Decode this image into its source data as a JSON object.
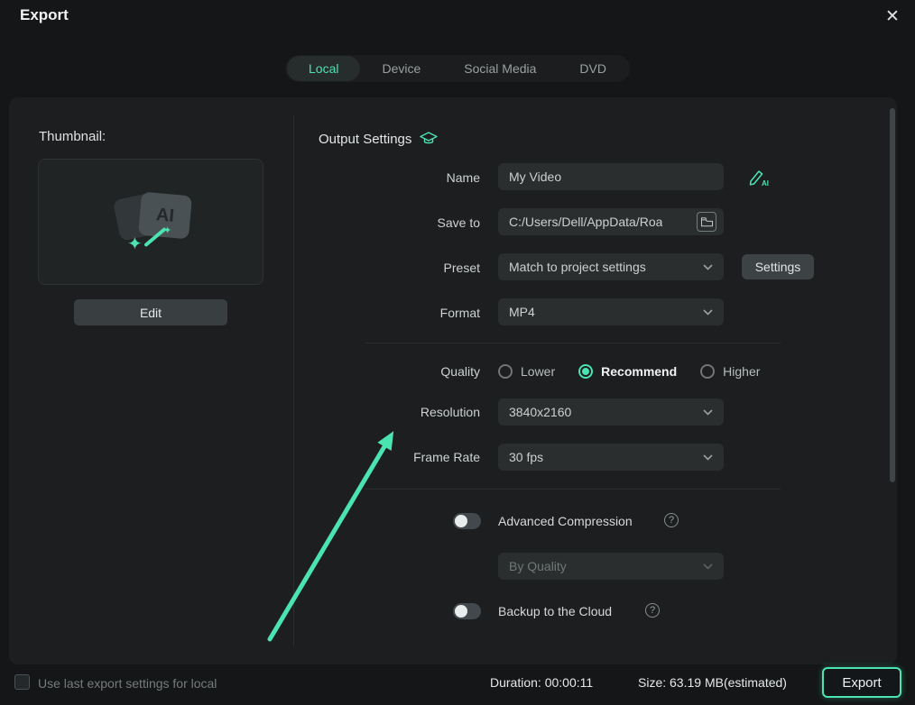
{
  "colors": {
    "accent": "#4be3b0"
  },
  "window": {
    "title": "Export",
    "close_icon": "✕"
  },
  "tabs": [
    {
      "label": "Local",
      "active": true
    },
    {
      "label": "Device",
      "active": false
    },
    {
      "label": "Social Media",
      "active": false
    },
    {
      "label": "DVD",
      "active": false
    }
  ],
  "left_panel": {
    "thumbnail_label": "Thumbnail:",
    "thumbnail_badge": "AI",
    "edit_button": "Edit"
  },
  "output_settings": {
    "title": "Output Settings",
    "name": {
      "label": "Name",
      "value": "My Video"
    },
    "save_to": {
      "label": "Save to",
      "value": "C:/Users/Dell/AppData/Roa"
    },
    "preset": {
      "label": "Preset",
      "value": "Match to project settings",
      "settings_button": "Settings"
    },
    "format": {
      "label": "Format",
      "value": "MP4"
    },
    "quality": {
      "label": "Quality",
      "options": [
        "Lower",
        "Recommend",
        "Higher"
      ],
      "selected": "Recommend"
    },
    "resolution": {
      "label": "Resolution",
      "value": "3840x2160"
    },
    "frame_rate": {
      "label": "Frame Rate",
      "value": "30 fps"
    },
    "advanced_compression": {
      "label": "Advanced Compression",
      "enabled": false,
      "quality_mode": "By Quality"
    },
    "backup": {
      "label": "Backup to the Cloud",
      "enabled": false
    }
  },
  "footer": {
    "checkbox_label": "Use last export settings for local",
    "checkbox_checked": false,
    "duration": "Duration: 00:00:11",
    "size": "Size: 63.19 MB(estimated)",
    "export_button": "Export"
  }
}
